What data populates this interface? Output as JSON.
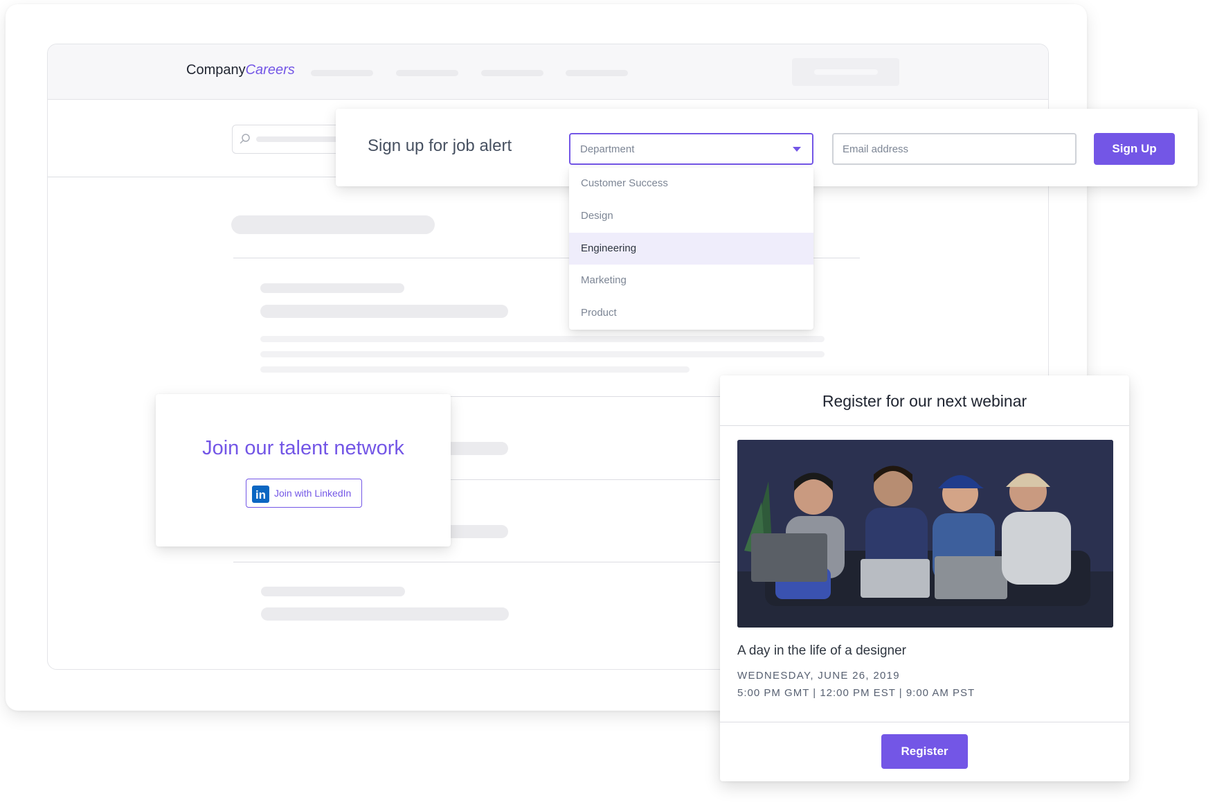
{
  "brand": {
    "company": "Company",
    "careers": "Careers"
  },
  "job_alert": {
    "title": "Sign up for job alert",
    "department_select": {
      "selected": "Department",
      "caret_icon": "caret-down-icon"
    },
    "email": {
      "placeholder": "Email address",
      "value": ""
    },
    "signup_label": "Sign Up",
    "dropdown_options": [
      {
        "label": "Customer Success",
        "highlighted": false
      },
      {
        "label": "Design",
        "highlighted": false
      },
      {
        "label": "Engineering",
        "highlighted": true
      },
      {
        "label": "Marketing",
        "highlighted": false
      },
      {
        "label": "Product",
        "highlighted": false
      }
    ]
  },
  "talent_network": {
    "title": "Join our talent network",
    "linkedin_logo": "in",
    "linkedin_label": "Join with LinkedIn"
  },
  "webinar": {
    "title": "Register for our next webinar",
    "image_description": "four people sitting on a couch with laptops",
    "subtitle": "A day in the life of a designer",
    "date": "WEDNESDAY, JUNE 26, 2019",
    "time": "5:00 PM GMT | 12:00 PM EST | 9:00 AM PST",
    "register_label": "Register"
  },
  "colors": {
    "accent": "#7356e6",
    "highlight": "#efedfb",
    "linkedin": "#0a66c2"
  }
}
